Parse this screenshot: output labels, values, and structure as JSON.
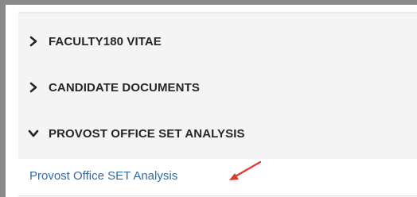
{
  "accordion": {
    "items": [
      {
        "label": "FACULTY180 VITAE",
        "state": "collapsed",
        "icon": "chevron-right-icon"
      },
      {
        "label": "CANDIDATE DOCUMENTS",
        "state": "collapsed",
        "icon": "chevron-right-icon"
      },
      {
        "label": "PROVOST OFFICE SET ANALYSIS",
        "state": "expanded",
        "icon": "chevron-down-icon"
      }
    ],
    "expanded_content": {
      "link_text": "Provost Office SET Analysis"
    }
  },
  "colors": {
    "accordion_background": "#f4f4f4",
    "link": "#2e6aa8",
    "annotation_arrow": "#e0392b",
    "frame_border": "#8a8a8a"
  }
}
